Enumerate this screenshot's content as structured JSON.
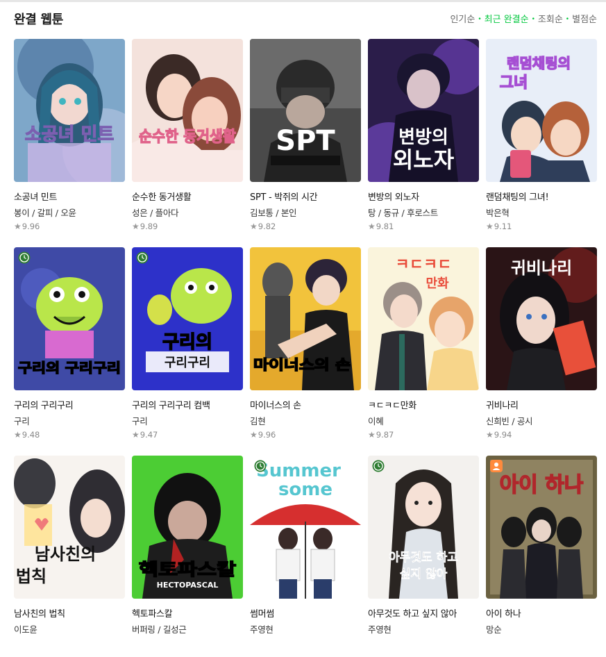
{
  "header": {
    "title": "완결 웹툰",
    "sorts": [
      {
        "label": "인기순",
        "active": false
      },
      {
        "label": "최근 완결순",
        "active": true
      },
      {
        "label": "조회순",
        "active": false
      },
      {
        "label": "별점순",
        "active": false
      }
    ]
  },
  "colors": {
    "accent": "#00c73c",
    "badge": "#2e7d32",
    "badge_orange": "#ff8a3d"
  },
  "rows": [
    [
      {
        "title": "소공녀 민트",
        "author": "봉이 / 갈피 / 오윤",
        "rating": "9.96",
        "cover_text": "소공녀 민트",
        "cover": "cover-somint",
        "badge": ""
      },
      {
        "title": "순수한 동거생활",
        "author": "성은 / 플아다",
        "rating": "9.89",
        "cover_text": "순수한 동거생활",
        "cover": "cover-sunsu",
        "badge": ""
      },
      {
        "title": "SPT - 박쥐의 시간",
        "author": "김보통 / 본인",
        "rating": "9.82",
        "cover_text": "SPT",
        "cover": "cover-spt",
        "badge": ""
      },
      {
        "title": "변방의 외노자",
        "author": "탕 / 동규 / 후로스트",
        "rating": "9.81",
        "cover_text": "변방의 외노자",
        "cover": "cover-byeonbang",
        "badge": ""
      },
      {
        "title": "랜덤채팅의 그녀!",
        "author": "박은혁",
        "rating": "9.11",
        "cover_text": "랜덤채팅의 그녀",
        "cover": "cover-random",
        "badge": ""
      }
    ],
    [
      {
        "title": "구리의 구리구리",
        "author": "구리",
        "rating": "9.48",
        "cover_text": "구리의 구리구리",
        "cover": "cover-guri1",
        "badge": "clock"
      },
      {
        "title": "구리의 구리구리 컴백",
        "author": "구리",
        "rating": "9.47",
        "cover_text": "구리의 구리구리",
        "cover": "cover-guri2",
        "badge": "clock"
      },
      {
        "title": "마이너스의 손",
        "author": "김현",
        "rating": "9.96",
        "cover_text": "마이너스의 손",
        "cover": "cover-minus",
        "badge": ""
      },
      {
        "title": "ㅋㄷㅋㄷ만화",
        "author": "이혜",
        "rating": "9.87",
        "cover_text": "ㅋㄷㅋㄷ 만화",
        "cover": "cover-kd",
        "badge": ""
      },
      {
        "title": "귀비나리",
        "author": "신희빈 / 공시",
        "rating": "9.94",
        "cover_text": "귀비나리",
        "cover": "cover-gwibi",
        "badge": ""
      }
    ],
    [
      {
        "title": "남사친의 법칙",
        "author": "이도윤",
        "rating": "",
        "cover_text": "남사친의 법칙",
        "cover": "cover-namsa",
        "badge": ""
      },
      {
        "title": "헥토파스칼",
        "author": "버퍼링 / 길성근",
        "rating": "",
        "cover_text": "헥토파스칼",
        "cover": "cover-hecto",
        "badge": ""
      },
      {
        "title": "썸머썸",
        "author": "주영현",
        "rating": "",
        "cover_text": "Summer some",
        "cover": "cover-summer",
        "badge": "clock"
      },
      {
        "title": "아무것도 하고 싶지 않아",
        "author": "주영현",
        "rating": "",
        "cover_text": "아무것도 하고 싶지 않아",
        "cover": "cover-amu",
        "badge": "clock"
      },
      {
        "title": "아이 하나",
        "author": "망순",
        "rating": "",
        "cover_text": "아이 하나",
        "cover": "cover-ai",
        "badge": "person"
      }
    ]
  ]
}
